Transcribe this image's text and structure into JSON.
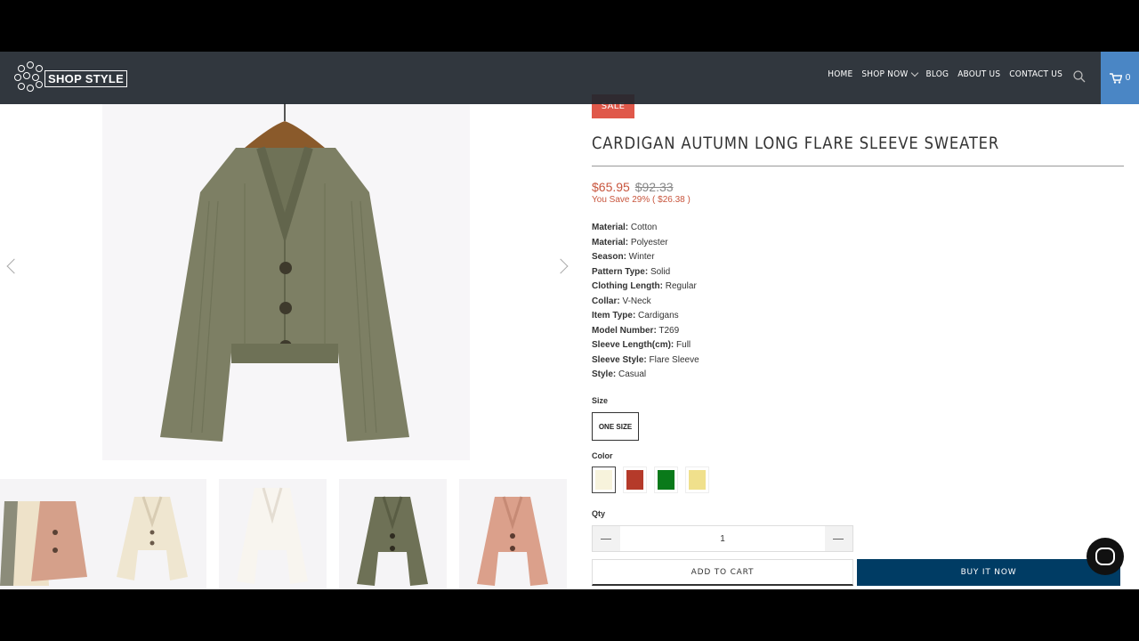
{
  "header": {
    "logo_text": "SHOP STYLE",
    "nav": [
      {
        "label": "HOME"
      },
      {
        "label": "SHOP NOW",
        "has_dropdown": true
      },
      {
        "label": "BLOG"
      },
      {
        "label": "ABOUT US"
      },
      {
        "label": "CONTACT US"
      }
    ],
    "search_icon": "search-icon",
    "cart_icon": "cart-icon",
    "cart_count": "0",
    "cart_color": "#4a86c5"
  },
  "gallery": {
    "main_image": "olive green cardigan on wooden hanger",
    "thumbnails": [
      "multi-color cardigans",
      "cream cardigan",
      "white cardigan",
      "olive cardigan",
      "pink cardigan"
    ]
  },
  "product": {
    "sale_badge": "SALE",
    "title": "CARDIGAN AUTUMN LONG FLARE SLEEVE SWEATER",
    "price_current": "$65.95",
    "price_compare": "$92.33",
    "savings": "You Save 29% ( $26.38 )",
    "attributes": [
      {
        "key": "Material:",
        "value": " Cotton"
      },
      {
        "key": "Material:",
        "value": " Polyester"
      },
      {
        "key": "Season:",
        "value": " Winter"
      },
      {
        "key": "Pattern Type:",
        "value": " Solid"
      },
      {
        "key": "Clothing Length:",
        "value": " Regular"
      },
      {
        "key": "Collar:",
        "value": " V-Neck"
      },
      {
        "key": "Item Type:",
        "value": " Cardigans"
      },
      {
        "key": "Model Number:",
        "value": " T269"
      },
      {
        "key": "Sleeve Length(cm):",
        "value": " Full"
      },
      {
        "key": "Sleeve Style:",
        "value": " Flare Sleeve"
      },
      {
        "key": "Style:",
        "value": " Casual"
      }
    ],
    "size_label": "Size",
    "size_value": "ONE SIZE",
    "color_label": "Color",
    "colors": [
      "#f7f3dc",
      "#b53a2a",
      "#0a7a1a",
      "#f0e08c"
    ],
    "qty_label": "Qty",
    "qty_value": "1",
    "add_to_cart": "ADD TO CART",
    "buy_now": "BUY IT NOW",
    "buy_now_color": "#003c64",
    "sale_color": "#e0584a"
  }
}
